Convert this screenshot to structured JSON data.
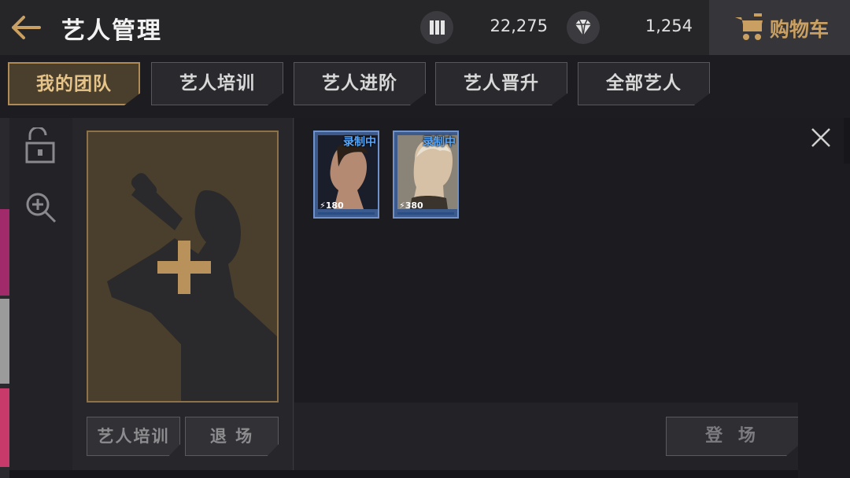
{
  "header": {
    "title": "艺人管理",
    "currency_1": {
      "icon": "record-icon",
      "value": "22,275"
    },
    "currency_2": {
      "icon": "diamond-icon",
      "value": "1,254"
    },
    "shop_label": "购物车"
  },
  "tabs": [
    {
      "label": "我的团队",
      "active": true
    },
    {
      "label": "艺人培训",
      "active": false
    },
    {
      "label": "艺人进阶",
      "active": false
    },
    {
      "label": "艺人晋升",
      "active": false
    },
    {
      "label": "全部艺人",
      "active": false
    }
  ],
  "slot_buttons": {
    "train": "艺人培训",
    "exit": "退 场"
  },
  "cards": [
    {
      "badge": "录制中",
      "power": "180"
    },
    {
      "badge": "录制中",
      "power": "380"
    }
  ],
  "debut_button": "登 场",
  "colors": {
    "accent": "#c9a062",
    "card_border": "#6e92c9",
    "badge": "#57a8ff"
  }
}
